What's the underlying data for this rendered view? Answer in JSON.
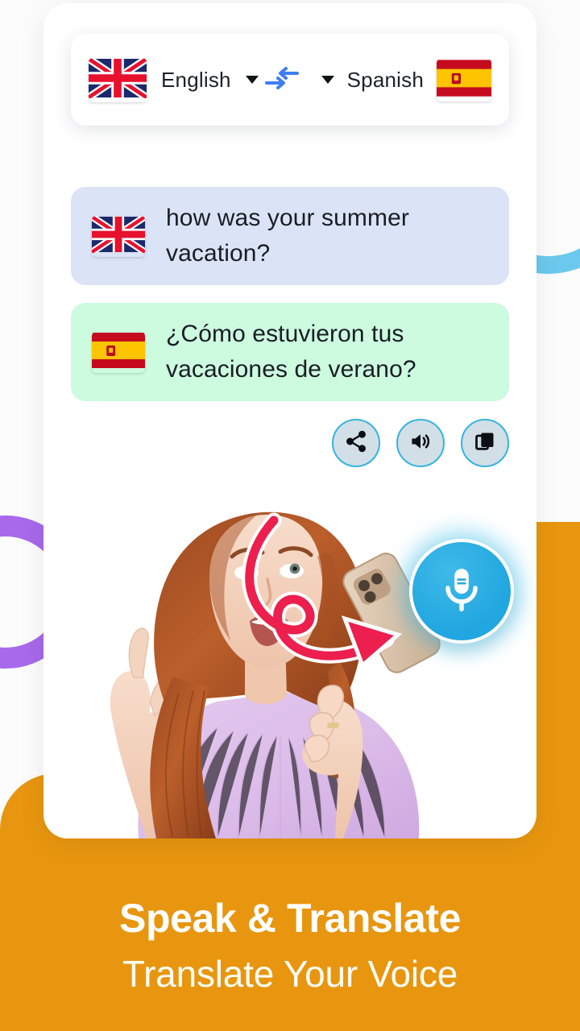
{
  "app": {
    "screen_name": "speak-and-translate-voice-translator"
  },
  "language_bar": {
    "source": {
      "label": "English",
      "flag": "uk-flag-icon",
      "dropdown_icon": "chevron-down-icon"
    },
    "swap": {
      "icon": "swap-arrows-icon",
      "color": "#3f7df5"
    },
    "target": {
      "label": "Spanish",
      "flag": "spain-flag-icon",
      "dropdown_icon": "chevron-down-icon"
    }
  },
  "conversation": [
    {
      "flag": "uk-flag-icon",
      "language": "English",
      "text": "how was your summer vacation?",
      "bg": "#dbe4f6"
    },
    {
      "flag": "spain-flag-icon",
      "language": "Spanish",
      "text": "¿Cómo estuvieron tus vacaciones de verano?",
      "bg": "#ccfbe0"
    }
  ],
  "actions": [
    {
      "name": "share-button",
      "icon": "share-icon"
    },
    {
      "name": "speak-button",
      "icon": "speaker-icon"
    },
    {
      "name": "copy-button",
      "icon": "copy-icon"
    }
  ],
  "mic": {
    "icon": "microphone-icon",
    "color": "#23a9e1"
  },
  "promo": {
    "headline": "Speak & Translate",
    "subline": "Translate Your Voice",
    "bg_color": "#e8960f",
    "text_color": "#ffffff"
  },
  "decorations": {
    "ring_purple": "#a869ea",
    "arc_blue": "#6cc9ee",
    "arrow_pink": "#ec1f4e"
  }
}
